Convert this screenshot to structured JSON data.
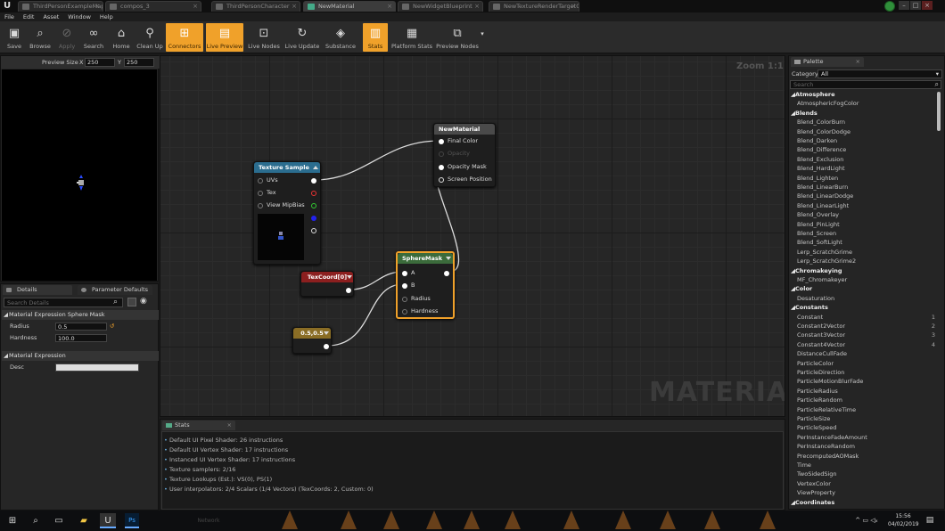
{
  "window": {
    "tabs": [
      {
        "label": "ThirdPersonExampleMap",
        "active": false
      },
      {
        "label": "compos_3",
        "active": false
      },
      {
        "label": "ThirdPersonCharacter",
        "active": false
      },
      {
        "label": "NewMaterial",
        "active": true
      },
      {
        "label": "NewWidgetBlueprint",
        "active": false
      },
      {
        "label": "NewTextureRenderTargetC",
        "active": false
      }
    ]
  },
  "menu": [
    "File",
    "Edit",
    "Asset",
    "Window",
    "Help"
  ],
  "toolbar": {
    "save": "Save",
    "browse": "Browse",
    "apply": "Apply",
    "search": "Search",
    "home": "Home",
    "clean_up": "Clean Up",
    "connectors": "Connectors",
    "live_preview": "Live Preview",
    "live_nodes": "Live Nodes",
    "live_update": "Live Update",
    "substance": "Substance",
    "stats": "Stats",
    "platform_stats": "Platform Stats",
    "preview_nodes": "Preview Nodes"
  },
  "preview": {
    "label": "Preview Size",
    "x_label": "X",
    "x_value": "250",
    "y_label": "Y",
    "y_value": "250"
  },
  "details": {
    "tab_details": "Details",
    "tab_defaults": "Parameter Defaults",
    "search_placeholder": "Search Details",
    "section_sphere": "Material Expression Sphere Mask",
    "radius_label": "Radius",
    "radius_value": "0.5",
    "hardness_label": "Hardness",
    "hardness_value": "100.0",
    "section_expr": "Material Expression",
    "desc_label": "Desc",
    "desc_value": ""
  },
  "graph": {
    "zoom": "Zoom 1:1",
    "watermark": "MATERIAL",
    "nodes": {
      "material": {
        "title": "NewMaterial",
        "pins": [
          "Final Color",
          "Opacity",
          "Opacity Mask",
          "Screen Position"
        ]
      },
      "texture": {
        "title": "Texture Sample",
        "pins": [
          "UVs",
          "Tex",
          "View MipBias"
        ]
      },
      "texcoord": {
        "title": "TexCoord[0]"
      },
      "spheremask": {
        "title": "SphereMask",
        "pins": [
          "A",
          "B",
          "Radius",
          "Hardness"
        ]
      },
      "constant": {
        "title": "0.5,0.5"
      }
    }
  },
  "stats": {
    "tab": "Stats",
    "lines": [
      "Default UI Pixel Shader: 26 instructions",
      "Default UI Vertex Shader: 17 instructions",
      "Instanced UI Vertex Shader: 17 instructions",
      "Texture samplers: 2/16",
      "Texture Lookups (Est.): VS(0), PS(1)",
      "User interpolators: 2/4 Scalars (1/4 Vectors) (TexCoords: 2, Custom: 0)"
    ]
  },
  "palette": {
    "tab": "Palette",
    "category_label": "Category",
    "category_value": "All",
    "search_placeholder": "Search",
    "items": [
      {
        "label": "Atmosphere",
        "cat": true
      },
      {
        "label": "AtmosphericFogColor"
      },
      {
        "label": "Blends",
        "cat": true
      },
      {
        "label": "Blend_ColorBurn"
      },
      {
        "label": "Blend_ColorDodge"
      },
      {
        "label": "Blend_Darken"
      },
      {
        "label": "Blend_Difference"
      },
      {
        "label": "Blend_Exclusion"
      },
      {
        "label": "Blend_HardLight"
      },
      {
        "label": "Blend_Lighten"
      },
      {
        "label": "Blend_LinearBurn"
      },
      {
        "label": "Blend_LinearDodge"
      },
      {
        "label": "Blend_LinearLight"
      },
      {
        "label": "Blend_Overlay"
      },
      {
        "label": "Blend_PinLight"
      },
      {
        "label": "Blend_Screen"
      },
      {
        "label": "Blend_SoftLight"
      },
      {
        "label": "Lerp_ScratchGrime"
      },
      {
        "label": "Lerp_ScratchGrime2"
      },
      {
        "label": "Chromakeying",
        "cat": true
      },
      {
        "label": "MF_Chromakeyer"
      },
      {
        "label": "Color",
        "cat": true
      },
      {
        "label": "Desaturation"
      },
      {
        "label": "Constants",
        "cat": true
      },
      {
        "label": "Constant",
        "key": "1"
      },
      {
        "label": "Constant2Vector",
        "key": "2"
      },
      {
        "label": "Constant3Vector",
        "key": "3"
      },
      {
        "label": "Constant4Vector",
        "key": "4"
      },
      {
        "label": "DistanceCullFade"
      },
      {
        "label": "ParticleColor"
      },
      {
        "label": "ParticleDirection"
      },
      {
        "label": "ParticleMotionBlurFade"
      },
      {
        "label": "ParticleRadius"
      },
      {
        "label": "ParticleRandom"
      },
      {
        "label": "ParticleRelativeTime"
      },
      {
        "label": "ParticleSize"
      },
      {
        "label": "ParticleSpeed"
      },
      {
        "label": "PerInstanceFadeAmount"
      },
      {
        "label": "PerInstanceRandom"
      },
      {
        "label": "PrecomputedAOMask"
      },
      {
        "label": "Time"
      },
      {
        "label": "TwoSidedSign"
      },
      {
        "label": "VertexColor"
      },
      {
        "label": "ViewProperty"
      },
      {
        "label": "Coordinates",
        "cat": true
      }
    ]
  },
  "taskbar": {
    "time": "15:56",
    "date": "04/02/2019",
    "network_label": "Network"
  }
}
